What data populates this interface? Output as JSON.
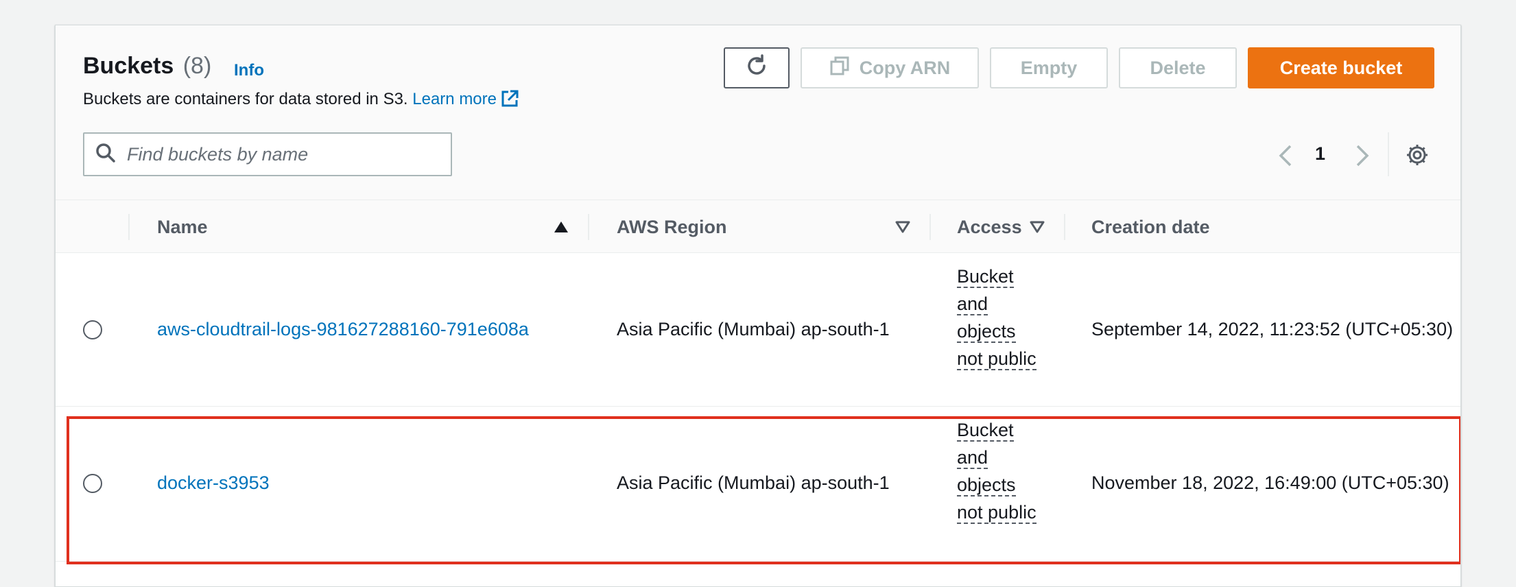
{
  "header": {
    "title": "Buckets",
    "count": "(8)",
    "info": "Info",
    "description": "Buckets are containers for data stored in S3.",
    "learn_more": "Learn more"
  },
  "toolbar": {
    "copy_arn": "Copy ARN",
    "empty": "Empty",
    "delete": "Delete",
    "create_bucket": "Create bucket"
  },
  "search": {
    "placeholder": "Find buckets by name"
  },
  "pagination": {
    "current_page": "1"
  },
  "table": {
    "columns": {
      "name": "Name",
      "region": "AWS Region",
      "access": "Access",
      "creation_date": "Creation date"
    },
    "rows": [
      {
        "name": "aws-cloudtrail-logs-981627288160-791e608a",
        "region": "Asia Pacific (Mumbai) ap-south-1",
        "access": "Bucket and objects not public",
        "creation_date": "September 14, 2022, 11:23:52 (UTC+05:30)"
      },
      {
        "name": "docker-s3953",
        "region": "Asia Pacific (Mumbai) ap-south-1",
        "access": "Bucket and objects not public",
        "creation_date": "November 18, 2022, 16:49:00 (UTC+05:30)"
      }
    ]
  },
  "colors": {
    "primary_button": "#ec7211",
    "link": "#0073bb",
    "highlight_border": "#e0301e"
  },
  "icons": {
    "refresh": "refresh-icon",
    "copy": "copy-icon",
    "external_link": "external-link-icon",
    "search": "search-icon",
    "prev": "chevron-left-icon",
    "next": "chevron-right-icon",
    "settings": "gear-icon",
    "sort_asc": "sort-ascending-icon",
    "sort_desc": "sort-descending-icon"
  }
}
